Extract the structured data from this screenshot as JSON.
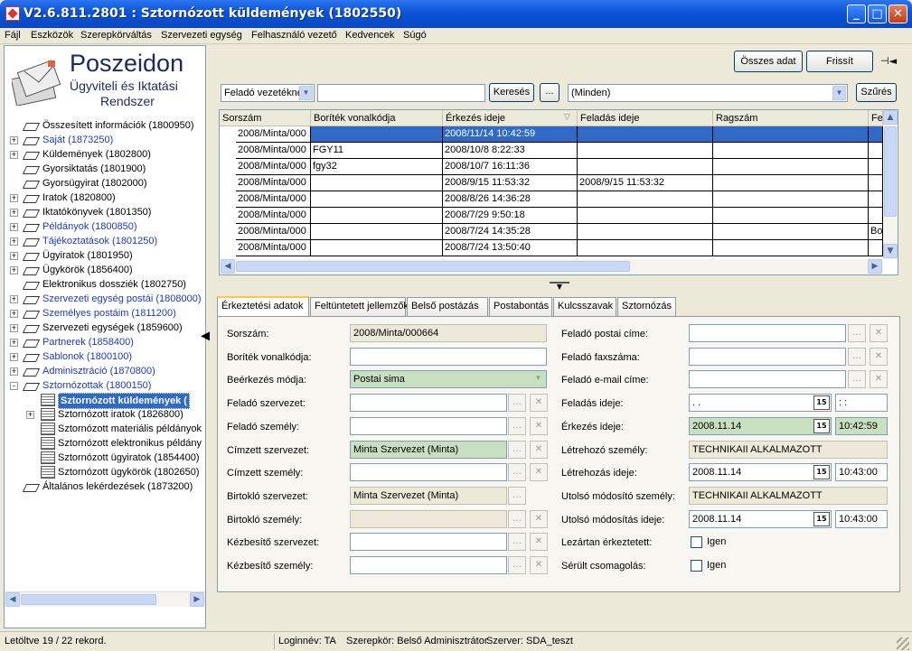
{
  "window": {
    "title": "V2.6.811.2801 : Sztornózott küldemények (1802550)",
    "minimize": "_",
    "maximize": "□",
    "close": "✕"
  },
  "menu": [
    "Fájl",
    "Eszközök",
    "Szerepkörváltás",
    "Szervezeti egység",
    "Felhasználó vezető",
    "Kedvencek",
    "Súgó"
  ],
  "logo": {
    "name": "Poszeidon",
    "sub1": "Ügyviteli és Iktatási",
    "sub2": "Rendszer"
  },
  "tree": [
    {
      "label": "Összesített információk (1800950)",
      "color": "black",
      "expander": ""
    },
    {
      "label": "Saját (1873250)",
      "color": "blue",
      "expander": "+"
    },
    {
      "label": "Küldemények (1802800)",
      "color": "black",
      "expander": "+"
    },
    {
      "label": "Gyorsiktatás (1801900)",
      "color": "black",
      "expander": ""
    },
    {
      "label": "Gyorsügyirat (1802000)",
      "color": "black",
      "expander": ""
    },
    {
      "label": "Iratok (1820800)",
      "color": "black",
      "expander": "+"
    },
    {
      "label": "Iktatókönyvek (1801350)",
      "color": "black",
      "expander": "+"
    },
    {
      "label": "Példányok (1800850)",
      "color": "blue",
      "expander": "+"
    },
    {
      "label": "Tájékoztatások (1801250)",
      "color": "blue",
      "expander": "+"
    },
    {
      "label": "Ügyiratok (1801950)",
      "color": "black",
      "expander": "+"
    },
    {
      "label": "Ügykörök (1856400)",
      "color": "black",
      "expander": "+"
    },
    {
      "label": "Elektronikus dossziék (1802750)",
      "color": "black",
      "expander": ""
    },
    {
      "label": "Szervezeti egység postái (1808000)",
      "color": "blue",
      "expander": "+"
    },
    {
      "label": "Személyes postáim (1811200)",
      "color": "blue",
      "expander": "+"
    },
    {
      "label": "Szervezeti egységek (1859600)",
      "color": "black",
      "expander": "+"
    },
    {
      "label": "Partnerek (1858400)",
      "color": "blue",
      "expander": "+"
    },
    {
      "label": "Sablonok (1800100)",
      "color": "blue",
      "expander": "+"
    },
    {
      "label": "Adminisztráció (1870800)",
      "color": "blue",
      "expander": "+"
    },
    {
      "label": "Sztornózottak (1800150)",
      "color": "blue",
      "expander": "-"
    }
  ],
  "tree_children": [
    {
      "label": "Sztornózott küldemények (",
      "selected": true,
      "expander": ""
    },
    {
      "label": "Sztornózott iratok (1826800)",
      "selected": false,
      "expander": "+"
    },
    {
      "label": "Sztornózott materiális példányok",
      "selected": false,
      "expander": ""
    },
    {
      "label": "Sztornózott elektronikus példány",
      "selected": false,
      "expander": ""
    },
    {
      "label": "Sztornózott ügyiratok (1854400)",
      "selected": false,
      "expander": ""
    },
    {
      "label": "Sztornózott ügykörök (1802650)",
      "selected": false,
      "expander": ""
    }
  ],
  "tree_last": {
    "label": "Általános lekérdezések (1873200)"
  },
  "toolbar": {
    "all_data": "Összes adat",
    "refresh": "Frissít",
    "pin": "⊣◄"
  },
  "search": {
    "field_select": "Feladó vezetékne",
    "search_value": "",
    "search_btn": "Keresés",
    "more_btn": "...",
    "filter_select": "(Minden)",
    "filter_btn": "Szűrés"
  },
  "grid": {
    "columns": [
      "Sorszám",
      "Boríték vonalkódja",
      "Érkezés ideje",
      "Feladás ideje",
      "Ragszám",
      "Fe"
    ],
    "rows": [
      {
        "sorszam": "2008/Minta/000",
        "vonalkod": "",
        "erkezes": "2008/11/14 10:42:59",
        "feladas": "",
        "ragszam": "",
        "fe": "",
        "selected": true
      },
      {
        "sorszam": "2008/Minta/000",
        "vonalkod": "FGY11",
        "erkezes": "2008/10/8 8:22:33",
        "feladas": "",
        "ragszam": "",
        "fe": "",
        "selected": false
      },
      {
        "sorszam": "2008/Minta/000",
        "vonalkod": "fgy32",
        "erkezes": "2008/10/7 16:11:36",
        "feladas": "",
        "ragszam": "",
        "fe": "",
        "selected": false
      },
      {
        "sorszam": "2008/Minta/000",
        "vonalkod": "",
        "erkezes": "2008/9/15 11:53:32",
        "feladas": "2008/9/15 11:53:32",
        "ragszam": "",
        "fe": "",
        "selected": false
      },
      {
        "sorszam": "2008/Minta/000",
        "vonalkod": "",
        "erkezes": "2008/8/26 14:36:28",
        "feladas": "",
        "ragszam": "",
        "fe": "",
        "selected": false
      },
      {
        "sorszam": "2008/Minta/000",
        "vonalkod": "",
        "erkezes": "2008/7/29 9:50:18",
        "feladas": "",
        "ragszam": "",
        "fe": "",
        "selected": false
      },
      {
        "sorszam": "2008/Minta/000",
        "vonalkod": "",
        "erkezes": "2008/7/24 14:35:28",
        "feladas": "",
        "ragszam": "",
        "fe": "Bol",
        "selected": false
      },
      {
        "sorszam": "2008/Minta/000",
        "vonalkod": "",
        "erkezes": "2008/7/24 13:50:40",
        "feladas": "",
        "ragszam": "",
        "fe": "",
        "selected": false
      }
    ]
  },
  "tabs": [
    "Érkeztetési adatok",
    "Feltüntetett jellemzők",
    "Belső postázás",
    "Postabontás",
    "Kulcsszavak",
    "Sztornózás"
  ],
  "form_left": [
    {
      "label": "Sorszám:",
      "value": "2008/Minta/000664",
      "style": "ro",
      "buttons": 0
    },
    {
      "label": "Boríték vonalkódja:",
      "value": "",
      "style": "white",
      "buttons": 0
    },
    {
      "label": "Beérkezés módja:",
      "value": "Postai sima",
      "style": "green-select",
      "buttons": 0
    },
    {
      "label": "Feladó szervezet:",
      "value": "",
      "style": "white",
      "buttons": 2
    },
    {
      "label": "Feladó személy:",
      "value": "",
      "style": "white",
      "buttons": 2
    },
    {
      "label": "Címzett szervezet:",
      "value": "Minta Szervezet (Minta)",
      "style": "green",
      "buttons": 2
    },
    {
      "label": "Címzett személy:",
      "value": "",
      "style": "white",
      "buttons": 2
    },
    {
      "label": "Birtokló szervezet:",
      "value": "Minta Szervezet  (Minta)",
      "style": "ro",
      "buttons": 1
    },
    {
      "label": "Birtokló személy:",
      "value": "",
      "style": "ro",
      "buttons": 2
    },
    {
      "label": "Kézbesítő szervezet:",
      "value": "",
      "style": "white",
      "buttons": 2
    },
    {
      "label": "Kézbesítő személy:",
      "value": "",
      "style": "white",
      "buttons": 2
    }
  ],
  "form_right": [
    {
      "label": "Feladó postai címe:",
      "value": "",
      "kind": "text2"
    },
    {
      "label": "Feladó faxszáma:",
      "value": "",
      "kind": "text2"
    },
    {
      "label": "Feladó e-mail címe:",
      "value": "",
      "kind": "text2"
    },
    {
      "label": "Feladás ideje:",
      "date": " .  .",
      "time": " :  :",
      "kind": "datetime",
      "green": false
    },
    {
      "label": "Érkezés ideje:",
      "date": "2008.11.14",
      "time": "10:42:59",
      "kind": "datetime",
      "green": true
    },
    {
      "label": "Létrehozó személy:",
      "value": "TECHNIKAII ALKALMAZOTT",
      "kind": "ro"
    },
    {
      "label": "Létrehozás ideje:",
      "date": "2008.11.14",
      "time": "10:43:00",
      "kind": "datetime",
      "green": false
    },
    {
      "label": "Utolsó módosító személy:",
      "value": "TECHNIKAII ALKALMAZOTT",
      "kind": "ro"
    },
    {
      "label": "Utolsó módosítás ideje:",
      "date": "2008.11.14",
      "time": "10:43:00",
      "kind": "datetime",
      "green": false
    },
    {
      "label": "Lezártan érkeztetett:",
      "check": "Igen",
      "kind": "check"
    },
    {
      "label": "Sérült csomagolás:",
      "check": "Igen",
      "kind": "check"
    }
  ],
  "status": {
    "records": "Letöltve 19 / 22 rekord.",
    "login": "Loginnév: TA",
    "role": "Szerepkör: Belső Adminisztrátor",
    "server": "Szerver: SDA_teszt"
  }
}
